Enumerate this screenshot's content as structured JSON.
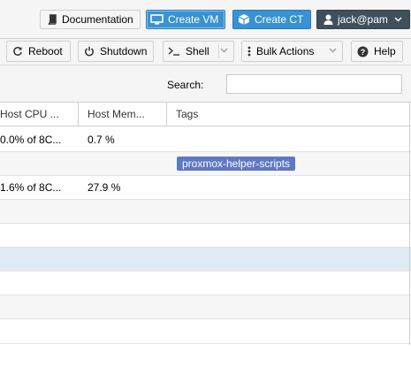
{
  "topbar": {
    "documentation_label": "Documentation",
    "create_vm_label": "Create VM",
    "create_ct_label": "Create CT",
    "user_label": "jack@pam"
  },
  "toolbar": {
    "reboot_label": "Reboot",
    "shutdown_label": "Shutdown",
    "shell_label": "Shell",
    "bulk_actions_label": "Bulk Actions",
    "help_label": "Help"
  },
  "search": {
    "label": "Search:",
    "value": "",
    "placeholder": ""
  },
  "table": {
    "columns": [
      "Host CPU ...",
      "Host Mem...",
      "Tags"
    ],
    "rows": [
      {
        "host_cpu": "0.0% of 8C...",
        "host_mem": "0.7 %",
        "tags": ""
      },
      {
        "host_cpu": "",
        "host_mem": "",
        "tags": "proxmox-helper-scripts"
      },
      {
        "host_cpu": "1.6% of 8C...",
        "host_mem": "27.9 %",
        "tags": ""
      },
      {
        "host_cpu": "",
        "host_mem": "",
        "tags": ""
      },
      {
        "host_cpu": "",
        "host_mem": "",
        "tags": ""
      },
      {
        "host_cpu": "",
        "host_mem": "",
        "tags": ""
      },
      {
        "host_cpu": "",
        "host_mem": "",
        "tags": ""
      },
      {
        "host_cpu": "",
        "host_mem": "",
        "tags": ""
      },
      {
        "host_cpu": "",
        "host_mem": "",
        "tags": ""
      }
    ]
  },
  "icons": {
    "documentation": "book-icon",
    "create_vm": "desktop-icon",
    "create_ct": "cube-icon",
    "user": "user-icon",
    "reboot": "refresh-icon",
    "shutdown": "power-icon",
    "shell": "terminal-icon",
    "bulk_actions": "ellipsis-vertical-icon",
    "help": "question-circle-icon"
  },
  "colors": {
    "primary_button": "#3892d4",
    "user_button": "#3f4f5b",
    "tag_background": "#5f78c2",
    "selected_row": "#dfeaf5",
    "alt_row": "#f7f7f7"
  }
}
